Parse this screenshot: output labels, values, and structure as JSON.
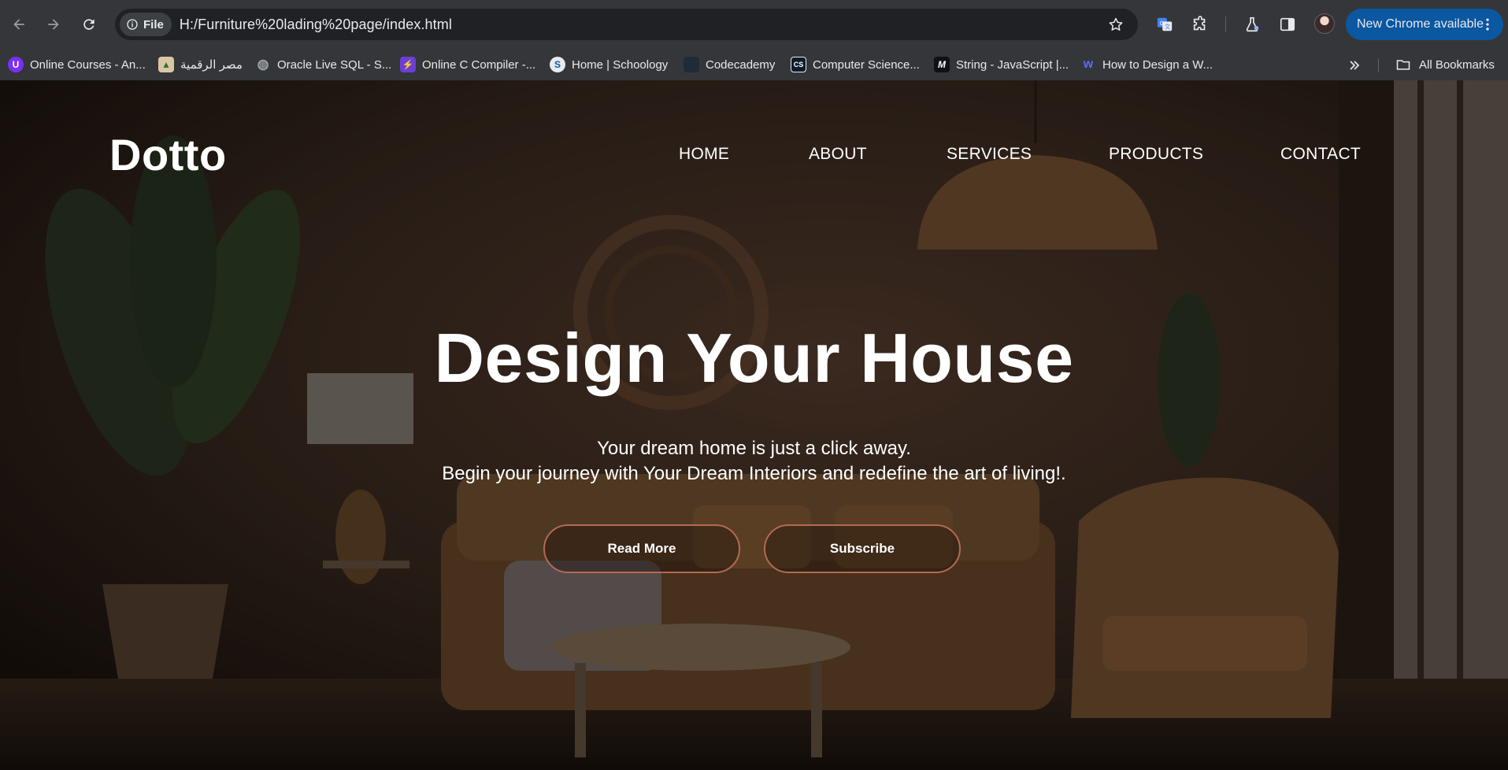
{
  "browser": {
    "site_chip_label": "File",
    "url": "H:/Furniture%20lading%20page/index.html",
    "update_label": "New Chrome available"
  },
  "bookmarks": [
    {
      "label": "Online Courses - An...",
      "color": "#7b2ff7",
      "glyph": "U"
    },
    {
      "label": "مصر الرقمية",
      "color": "#d9c7a3",
      "glyph": "▲"
    },
    {
      "label": "Oracle Live SQL - S...",
      "color": "#9aa0a6",
      "glyph": "◍"
    },
    {
      "label": "Online C Compiler -...",
      "color": "#6b3fd6",
      "glyph": "⚡"
    },
    {
      "label": "Home | Schoology",
      "color": "#e8eaed",
      "glyph": "S"
    },
    {
      "label": "Codecademy",
      "color": "#1f2b3a",
      "glyph": ""
    },
    {
      "label": "Computer Science...",
      "color": "#0d1b2a",
      "glyph": "CS"
    },
    {
      "label": "String - JavaScript |...",
      "color": "#111111",
      "glyph": "M"
    },
    {
      "label": "How to Design a W...",
      "color": "#3d5afe",
      "glyph": "w"
    }
  ],
  "all_bookmarks_label": "All Bookmarks",
  "site": {
    "brand": "Dotto",
    "nav": [
      "HOME",
      "ABOUT",
      "SERVICES",
      "PRODUCTS",
      "CONTACT"
    ],
    "hero_title": "Design Your House",
    "hero_line1": "Your dream home is just a click away.",
    "hero_line2": "Begin your journey with Your Dream Interiors and redefine the art of living!.",
    "read_more": "Read More",
    "subscribe": "Subscribe",
    "accent_color": "#b36a52"
  }
}
